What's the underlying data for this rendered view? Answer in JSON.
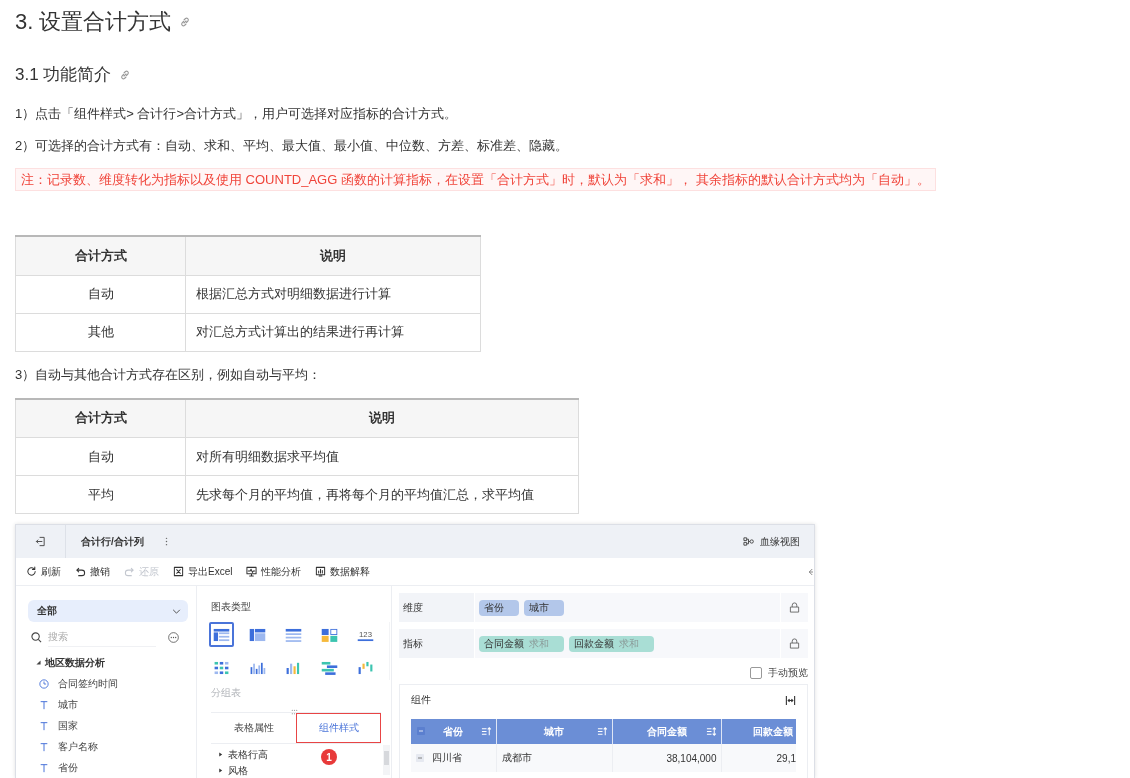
{
  "page_title": {
    "text": "3. 设置合计方式"
  },
  "section_title": {
    "text": "3.1 功能简介"
  },
  "blocks": [
    {
      "kind": "paragraph",
      "text": "1）点击「组件样式> 合计行>合计方式」，用户可选择对应指标的合计方式。"
    },
    {
      "kind": "paragraph",
      "text": "2）可选择的合计方式有：自动、求和、平均、最大值、最小值、中位数、方差、标准差、隐藏。"
    },
    {
      "kind": "note",
      "text": "注：记录数、维度转化为指标以及使用 COUNTD_AGG 函数的计算指标，在设置「合计方式」时，默认为「求和」， 其余指标的默认合计方式均为「自动」。"
    },
    {
      "kind": "table",
      "columns": [
        "合计方式",
        "说明"
      ],
      "rows": [
        [
          "自动",
          "根据汇总方式对明细数据进行计算"
        ],
        [
          "其他",
          "对汇总方式计算出的结果进行再计算"
        ]
      ]
    },
    {
      "kind": "paragraph",
      "text": "3）自动与其他合计方式存在区别，例如自动与平均："
    },
    {
      "kind": "table",
      "columns": [
        "合计方式",
        "说明"
      ],
      "rows": [
        [
          "自动",
          "对所有明细数据求平均值"
        ],
        [
          "平均",
          "先求每个月的平均值，再将每个月的平均值汇总，求平均值"
        ]
      ]
    }
  ],
  "app_window": {
    "title": "合计行/合计列",
    "lineage_button": "血缘视图",
    "toolbar": [
      {
        "label": "刷新",
        "disabled": false
      },
      {
        "label": "撤销",
        "disabled": false
      },
      {
        "label": "还原",
        "disabled": true
      },
      {
        "label": "导出Excel",
        "disabled": false
      },
      {
        "label": "性能分析",
        "disabled": false
      },
      {
        "label": "数据解释",
        "disabled": false
      }
    ],
    "data_panel": {
      "scope": "全部",
      "search": {
        "placeholder": "搜索"
      },
      "tree": [
        {
          "label": "地区数据分析",
          "expanded": true,
          "children": [
            {
              "label": "合同签约时间",
              "kind": "date"
            },
            {
              "label": "城市",
              "kind": "text"
            },
            {
              "label": "国家",
              "kind": "text"
            },
            {
              "label": "客户名称",
              "kind": "text"
            },
            {
              "label": "省份",
              "kind": "text"
            }
          ]
        }
      ]
    },
    "chart_panel": {
      "title": "图表类型",
      "chart_types": [
        {
          "kind": "grouped",
          "selected": true
        },
        {
          "kind": "cross",
          "selected": false
        },
        {
          "kind": "detail",
          "selected": false
        },
        {
          "kind": "blocks",
          "selected": false
        },
        {
          "kind": "number",
          "label": "123",
          "selected": false
        },
        {
          "kind": "dots",
          "selected": false
        },
        {
          "kind": "bars",
          "selected": false
        },
        {
          "kind": "colorbars",
          "selected": false
        },
        {
          "kind": "hbars",
          "selected": false
        },
        {
          "kind": "floating",
          "selected": false
        }
      ],
      "selected_type_name": "分组表",
      "tabs": [
        {
          "label": "表格属性",
          "selected": false,
          "highlighted": false
        },
        {
          "label": "组件样式",
          "selected": true,
          "highlighted": true,
          "step": "1"
        }
      ],
      "sections": [
        {
          "label": "表格行高",
          "expanded": false
        },
        {
          "label": "风格",
          "expanded": false
        }
      ]
    },
    "fields_panel": {
      "rows": [
        {
          "label": "维度",
          "kind": "dimension",
          "chips": [
            {
              "name": "省份"
            },
            {
              "name": "城市"
            }
          ]
        },
        {
          "label": "指标",
          "kind": "measure",
          "chips": [
            {
              "name": "合同金额",
              "aggregation": "求和"
            },
            {
              "name": "回款金额",
              "aggregation": "求和"
            }
          ]
        }
      ],
      "manual_preview": {
        "label": "手动预览",
        "checked": false
      },
      "component": {
        "title": "组件",
        "table": {
          "header_expanded": true,
          "columns": [
            {
              "label": "省份",
              "kind": "dimension",
              "sortable": true,
              "sorted": true
            },
            {
              "label": "城市",
              "kind": "dimension",
              "sortable": true,
              "sorted": true
            },
            {
              "label": "合同金额",
              "kind": "measure",
              "sortable": true,
              "sorted": false
            },
            {
              "label": "回款金额",
              "kind": "measure",
              "sortable": false
            }
          ],
          "rows": [
            {
              "expanded": true,
              "cells": [
                "四川省",
                "成都市",
                "38,104,000",
                "29,1"
              ]
            }
          ]
        }
      }
    }
  }
}
